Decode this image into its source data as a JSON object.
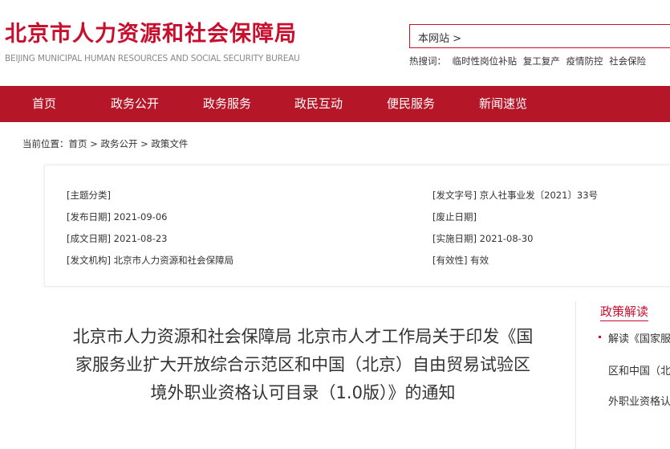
{
  "header": {
    "logo_cn": "北京市人力资源和社会保障局",
    "logo_en": "BEIJING MUNICIPAL HUMAN RESOURCES AND SOCIAL SECURITY BUREAU",
    "search_scope": "本网站 >",
    "hot_label": "热搜词：",
    "hot_words": [
      "临时性岗位补贴",
      "复工复产",
      "疫情防控",
      "社会保险"
    ]
  },
  "nav": {
    "items": [
      "首页",
      "政务公开",
      "政务服务",
      "政民互动",
      "便民服务",
      "新闻速览"
    ]
  },
  "breadcrumb": "当前位置：首页 > 政务公开 > 政策文件",
  "meta": {
    "topic": "[主题分类]",
    "publish_date": "[发布日期]  2021-09-06",
    "create_date": "[成文日期]  2021-08-23",
    "issuer": "[发文机构]  北京市人力资源和社会保障局",
    "doc_no": "[发文字号]  京人社事业发〔2021〕33号",
    "repeal_date": "[废止日期]",
    "effective_date": "[实施日期]  2021-08-30",
    "validity": "[有效性]  有效"
  },
  "article": {
    "title": "北京市人力资源和社会保障局 北京市人才工作局关于印发《国家服务业扩大开放综合示范区和中国（北京）自由贸易试验区境外职业资格认可目录（1.0版）》的通知"
  },
  "sidebar": {
    "title": "政策解读",
    "lines": [
      "解读《国家服",
      "区和中国（北",
      "外职业资格认"
    ]
  },
  "colors": {
    "brand_red": "#c8102e",
    "nav_red": "#b51728"
  }
}
